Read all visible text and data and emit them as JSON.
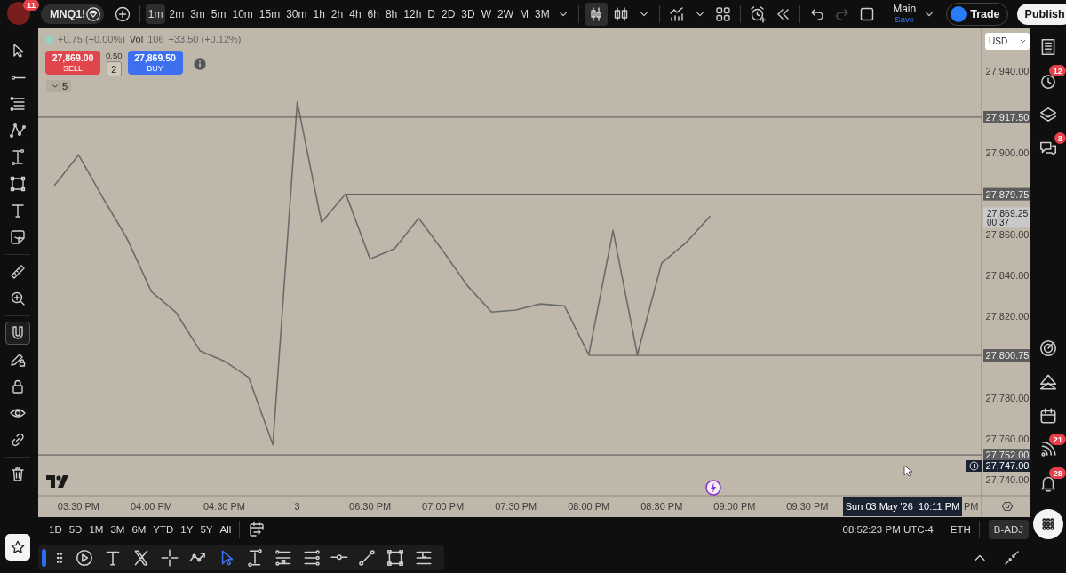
{
  "top_bar": {
    "avatar": {
      "badge": "11"
    },
    "symbol": "MNQ1!",
    "intervals": [
      {
        "label": "1m",
        "selected": true
      },
      {
        "label": "2m",
        "selected": false
      },
      {
        "label": "3m",
        "selected": false
      },
      {
        "label": "5m",
        "selected": false
      },
      {
        "label": "10m",
        "selected": false
      },
      {
        "label": "15m",
        "selected": false
      },
      {
        "label": "30m",
        "selected": false
      },
      {
        "label": "1h",
        "selected": false
      },
      {
        "label": "2h",
        "selected": false
      },
      {
        "label": "4h",
        "selected": false
      },
      {
        "label": "6h",
        "selected": false
      },
      {
        "label": "8h",
        "selected": false
      },
      {
        "label": "12h",
        "selected": false
      },
      {
        "label": "D",
        "selected": false
      },
      {
        "label": "2D",
        "selected": false
      },
      {
        "label": "3D",
        "selected": false
      },
      {
        "label": "W",
        "selected": false
      },
      {
        "label": "2W",
        "selected": false
      },
      {
        "label": "M",
        "selected": false
      },
      {
        "label": "3M",
        "selected": false
      }
    ],
    "chart_types": [
      {
        "kind": "candles",
        "selected": true
      },
      {
        "kind": "hollow-candles",
        "selected": false
      }
    ],
    "history": [
      {
        "kind": "undo",
        "disabled": false
      },
      {
        "kind": "redo",
        "disabled": true
      }
    ],
    "layout": {
      "name": "Main",
      "status": "Save"
    },
    "trade_button": "Trade",
    "publish_button": "Publish"
  },
  "left_toolbar": {
    "tool_groups": [
      {
        "tools": [
          {
            "kind": "cursor",
            "selected": false
          },
          {
            "kind": "line-dot",
            "selected": false
          },
          {
            "kind": "stacked-lines",
            "selected": false
          },
          {
            "kind": "zigzag",
            "selected": false
          },
          {
            "kind": "i-beam",
            "selected": false
          },
          {
            "kind": "square-nodes",
            "selected": false
          },
          {
            "kind": "text",
            "selected": false
          },
          {
            "kind": "sticker",
            "selected": false
          }
        ]
      },
      {
        "tools": [
          {
            "kind": "ruler",
            "selected": false
          },
          {
            "kind": "zoom-in",
            "selected": false
          }
        ]
      },
      {
        "tools": [
          {
            "kind": "magnet",
            "selected": true
          },
          {
            "kind": "pencil-lock",
            "selected": false
          },
          {
            "kind": "lock",
            "selected": false
          },
          {
            "kind": "eye",
            "selected": false
          },
          {
            "kind": "link",
            "selected": false
          }
        ]
      },
      {
        "tools": [
          {
            "kind": "trash",
            "selected": false
          }
        ]
      }
    ]
  },
  "legend": {
    "change": "+0.75 (+0.00%)",
    "volume_label": "Vol",
    "volume": "106",
    "volume_change": "+33.50 (+0.12%)"
  },
  "order_panel": {
    "sell": {
      "price": "27,869.00",
      "label": "SELL"
    },
    "spread": "0.50",
    "quantity": "2",
    "buy": {
      "price": "27,869.50",
      "label": "BUY"
    }
  },
  "indicators_toggle": {
    "count": "5"
  },
  "chart": {
    "currency": "USD",
    "last_price": {
      "price": "27,869.25",
      "countdown": "00:37"
    },
    "crosshair": {
      "price": "27,747.00",
      "time": "Sun 03 May '26  10:11 PM"
    },
    "chart_data": {
      "type": "line",
      "categories": [
        null,
        "03:30 PM",
        null,
        null,
        "04:00 PM",
        null,
        null,
        "04:30 PM",
        null,
        null,
        "3",
        null,
        null,
        "06:30 PM",
        null,
        null,
        "07:00 PM",
        null,
        null,
        "07:30 PM",
        null,
        null,
        "08:00 PM",
        null,
        null,
        "08:30 PM",
        null,
        null,
        "09:00 PM",
        null,
        null,
        "09:30 PM",
        null,
        null,
        null,
        null,
        null,
        "PM",
        null
      ],
      "series": [
        {
          "color": "#6b6b6b",
          "values": [
            27884,
            27899,
            27878,
            27858,
            27832,
            27822,
            27803,
            27798,
            27790,
            27757,
            27925,
            27866,
            27880,
            27848,
            27853,
            27868,
            27852,
            27835,
            27822,
            27823,
            27826,
            27825,
            27801,
            27862,
            27801,
            27846,
            27856,
            27869,
            null,
            null,
            null,
            null,
            null,
            null,
            null,
            null,
            null,
            null,
            null
          ]
        }
      ],
      "ylim": [
        27732,
        27961
      ],
      "yticks": [
        {
          "value": 27940,
          "label": "27,940.00"
        },
        {
          "value": 27900,
          "label": "27,900.00"
        },
        {
          "value": 27860,
          "label": "27,860.00"
        },
        {
          "value": 27840,
          "label": "27,840.00"
        },
        {
          "value": 27820,
          "label": "27,820.00"
        },
        {
          "value": 27780,
          "label": "27,780.00"
        },
        {
          "value": 27760,
          "label": "27,760.00"
        },
        {
          "value": 27740,
          "label": "27,740.00"
        }
      ],
      "ref_lines": [
        {
          "axis": "y",
          "value": 27917.5,
          "label": "27,917.50"
        },
        {
          "axis": "y",
          "value": 27879.75,
          "label": "27,879.75"
        },
        {
          "axis": "y",
          "value": 27800.75,
          "label": "27,800.75"
        },
        {
          "axis": "y",
          "value": 27752,
          "label": "27,752.00"
        }
      ]
    }
  },
  "range_bar": {
    "ranges": [
      "1D",
      "5D",
      "1M",
      "3M",
      "6M",
      "YTD",
      "1Y",
      "5Y",
      "All"
    ],
    "clock": "08:52:23 PM UTC-4",
    "session": "ETH",
    "adjustment": {
      "label": "B-ADJ",
      "selected": true
    }
  },
  "drawing_toolbar": {
    "tools": [
      {
        "kind": "play-circle",
        "selected": false
      },
      {
        "kind": "text",
        "selected": false
      },
      {
        "kind": "cross-shape",
        "selected": false
      },
      {
        "kind": "crosshair",
        "selected": false
      },
      {
        "kind": "path",
        "selected": false
      },
      {
        "kind": "cursor",
        "selected": true
      },
      {
        "kind": "i-beam",
        "selected": false
      },
      {
        "kind": "price-range",
        "selected": false
      },
      {
        "kind": "parallel-lines",
        "selected": false
      },
      {
        "kind": "horizontal-line",
        "selected": false
      },
      {
        "kind": "line-segment",
        "selected": false
      },
      {
        "kind": "square-nodes",
        "selected": false
      },
      {
        "kind": "label-lines",
        "selected": false
      }
    ]
  },
  "right_sidebar": {
    "top_items": [
      {
        "kind": "list"
      },
      {
        "kind": "clock",
        "badge": "12"
      },
      {
        "kind": "layers"
      },
      {
        "kind": "chat",
        "badge": "3"
      }
    ],
    "bottom_items": [
      {
        "kind": "target"
      },
      {
        "kind": "peaks"
      },
      {
        "kind": "calendar"
      },
      {
        "kind": "broadcast",
        "badge": "21"
      },
      {
        "kind": "bell",
        "badge": "28"
      }
    ]
  }
}
